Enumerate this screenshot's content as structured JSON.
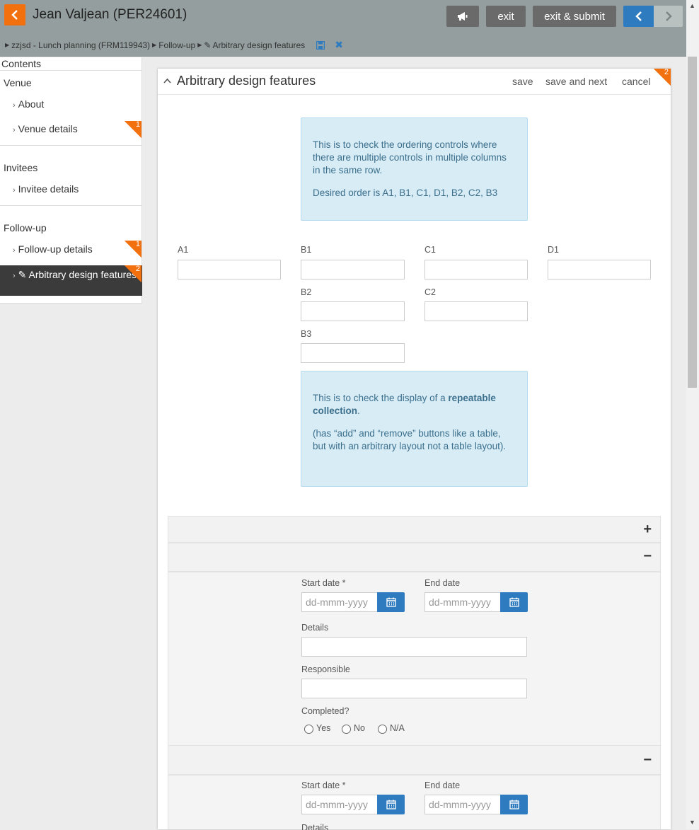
{
  "header": {
    "back_icon": "chevron-left-icon",
    "person": "Jean Valjean (PER24601)",
    "announce_icon": "megaphone-icon",
    "exit_label": "exit",
    "exit_submit_label": "exit & submit",
    "prev_icon": "chevron-left-icon",
    "next_icon": "chevron-right-icon",
    "breadcrumb": {
      "form": "zzjsd - Lunch planning (FRM119943)",
      "section": "Follow-up",
      "page": "Arbitrary design features"
    }
  },
  "sidebar": {
    "title": "Contents",
    "sections": [
      {
        "title": "Venue",
        "items": [
          {
            "label": "About"
          },
          {
            "label": "Venue details",
            "badge": "1"
          }
        ]
      },
      {
        "title": "Invitees",
        "items": [
          {
            "label": "Invitee details"
          }
        ]
      },
      {
        "title": "Follow-up",
        "items": [
          {
            "label": "Follow-up details",
            "badge": "1"
          },
          {
            "label": "Arbitrary design features",
            "badge": "2"
          }
        ]
      }
    ]
  },
  "panel": {
    "title": "Arbitrary design features",
    "save": "save",
    "save_next": "save and next",
    "cancel": "cancel",
    "badge": "2",
    "info1": {
      "p1": "This is to check the ordering controls where there are multiple controls in multiple columns in the same row.",
      "p2": "Desired order is A1, B1, C1, D1, B2, C2, B3"
    },
    "fields": {
      "a1": "A1",
      "b1": "B1",
      "c1": "C1",
      "d1": "D1",
      "b2": "B2",
      "c2": "C2",
      "b3": "B3"
    },
    "info2": {
      "p1_pre": "This is to check the display of a ",
      "p1_bold": "repeatable collection",
      "p1_post": ".",
      "p2": "(has “add” and “remove” buttons like a table, but with an arbitrary layout not a table layout)."
    },
    "collection": {
      "add": "+",
      "remove": "−",
      "start_date": "Start date *",
      "end_date": "End date",
      "date_placeholder": "dd-mmm-yyyy",
      "details": "Details",
      "responsible": "Responsible",
      "completed": "Completed?",
      "options": [
        "Yes",
        "No",
        "N/A"
      ]
    }
  },
  "colors": {
    "accent": "#f2700d",
    "primary": "#2f7bbf",
    "header": "#949e9e",
    "info_bg": "#d8ecf6"
  }
}
